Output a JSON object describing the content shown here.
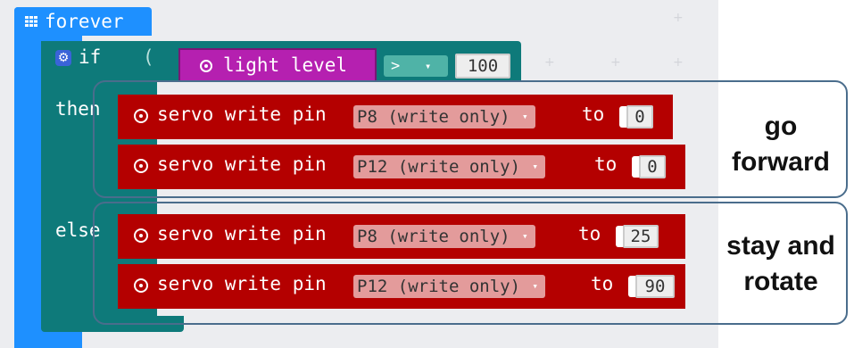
{
  "forever": {
    "label": "forever",
    "icon": "grid-icon"
  },
  "if_block": {
    "if_label": "if",
    "then_label": "then",
    "else_label": "else",
    "gear_icon": "gear-icon"
  },
  "condition": {
    "sensor_label": "light level",
    "operator": ">",
    "operator_arrow": "▾",
    "value": "100"
  },
  "then_blocks": [
    {
      "text": "servo write pin",
      "pin": "P8 (write only)",
      "to": "to",
      "value": "0"
    },
    {
      "text": "servo write pin",
      "pin": "P12 (write only)",
      "to": "to",
      "value": "0"
    }
  ],
  "else_blocks": [
    {
      "text": "servo write pin",
      "pin": "P8 (write only)",
      "to": "to",
      "value": "25"
    },
    {
      "text": "servo write pin",
      "pin": "P12 (write only)",
      "to": "to",
      "value": "90"
    }
  ],
  "annotations": {
    "then_note_line1": "go",
    "then_note_line2": "forward",
    "else_note_line1": "stay and",
    "else_note_line2": "rotate"
  },
  "dropdown_arrow": "▾",
  "colors": {
    "forever": "#1e90ff",
    "logic": "#0e7a7a",
    "servo": "#b40000",
    "sensor": "#b520b0",
    "pin_dropdown": "#e39b9b"
  }
}
